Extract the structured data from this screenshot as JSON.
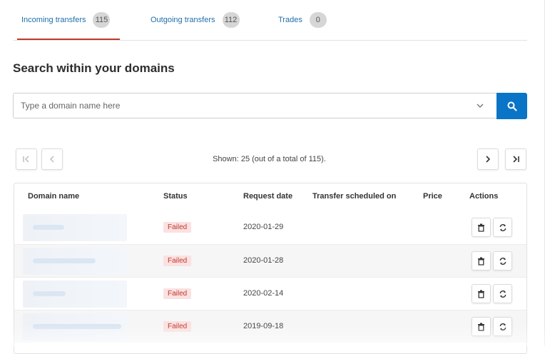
{
  "tabs": [
    {
      "label": "Incoming transfers",
      "count": "115",
      "active": true
    },
    {
      "label": "Outgoing transfers",
      "count": "112",
      "active": false
    },
    {
      "label": "Trades",
      "count": "0",
      "active": false
    }
  ],
  "heading": "Search within your domains",
  "search": {
    "placeholder": "Type a domain name here",
    "value": ""
  },
  "pager": {
    "shown_text": "Shown: 25 (out of a total of 115)."
  },
  "table": {
    "columns": [
      "Domain name",
      "Status",
      "Request date",
      "Transfer scheduled on",
      "Price",
      "Actions"
    ],
    "rows": [
      {
        "domain": "",
        "status": "Failed",
        "request_date": "2020-01-29",
        "scheduled": "",
        "price": ""
      },
      {
        "domain": "",
        "status": "Failed",
        "request_date": "2020-01-28",
        "scheduled": "",
        "price": ""
      },
      {
        "domain": "",
        "status": "Failed",
        "request_date": "2020-02-14",
        "scheduled": "",
        "price": ""
      },
      {
        "domain": "",
        "status": "Failed",
        "request_date": "2019-09-18",
        "scheduled": "",
        "price": ""
      }
    ]
  },
  "icons": {
    "search_button": "magnifier-icon",
    "dropdown": "chevron-down-icon",
    "first_page": "first-page-icon",
    "prev_page": "chevron-left-icon",
    "next_page": "chevron-right-icon",
    "last_page": "last-page-icon",
    "delete": "trash-icon",
    "retry": "refresh-icon"
  },
  "colors": {
    "accent": "#0a74c6",
    "tab_text": "#1e6fa8",
    "active_underline": "#c0392b",
    "badge_bg": "#fbe1e1",
    "badge_text": "#c0392b"
  }
}
